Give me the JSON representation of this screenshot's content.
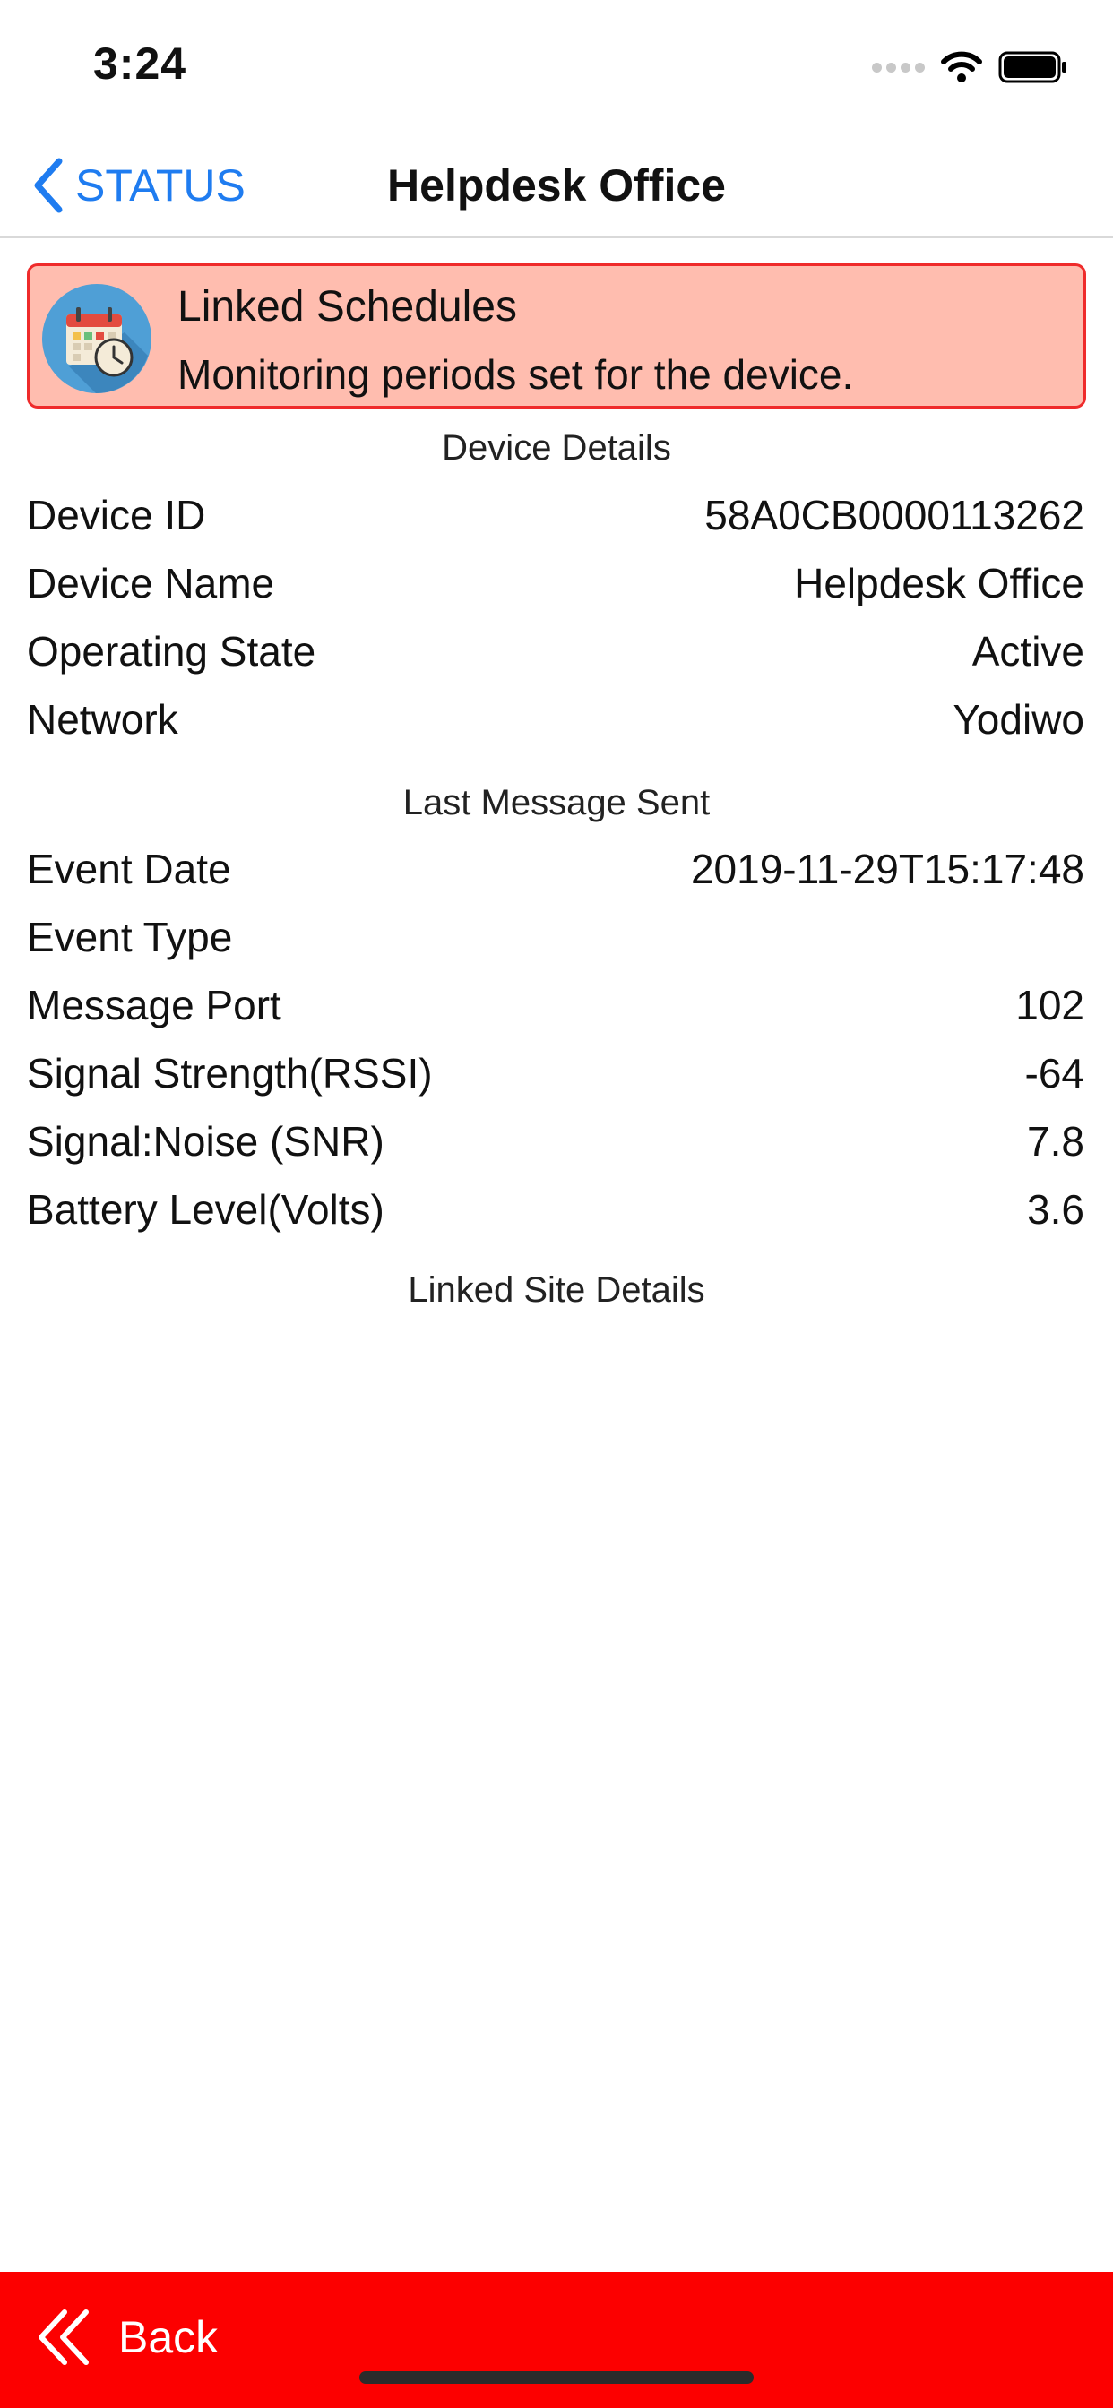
{
  "status_bar": {
    "time": "3:24"
  },
  "nav": {
    "back_label": "STATUS",
    "title": "Helpdesk Office"
  },
  "banner": {
    "title": "Linked Schedules",
    "subtitle": "Monitoring periods set for the device.",
    "icon": "calendar-clock-icon",
    "background_color": "#ffbdaf",
    "border_color": "#ef2b2b"
  },
  "device_details": {
    "header": "Device Details",
    "rows": [
      {
        "label": "Device ID",
        "value": "58A0CB0000113262"
      },
      {
        "label": "Device Name",
        "value": "Helpdesk Office"
      },
      {
        "label": "Operating State",
        "value": "Active"
      },
      {
        "label": "Network",
        "value": "Yodiwo"
      }
    ]
  },
  "last_message": {
    "header": "Last Message Sent",
    "rows": [
      {
        "label": "Event Date",
        "value": "2019-11-29T15:17:48"
      },
      {
        "label": "Event Type",
        "value": ""
      },
      {
        "label": "Message Port",
        "value": "102"
      },
      {
        "label": "Signal Strength(RSSI)",
        "value": "-64"
      },
      {
        "label": "Signal:Noise (SNR)",
        "value": "7.8"
      },
      {
        "label": "Battery Level(Volts)",
        "value": "3.6"
      }
    ]
  },
  "linked_site": {
    "header": "Linked Site Details"
  },
  "bottom_bar": {
    "back_label": "Back",
    "background_color": "#fc0000"
  },
  "colors": {
    "accent": "#1f7cf0"
  }
}
